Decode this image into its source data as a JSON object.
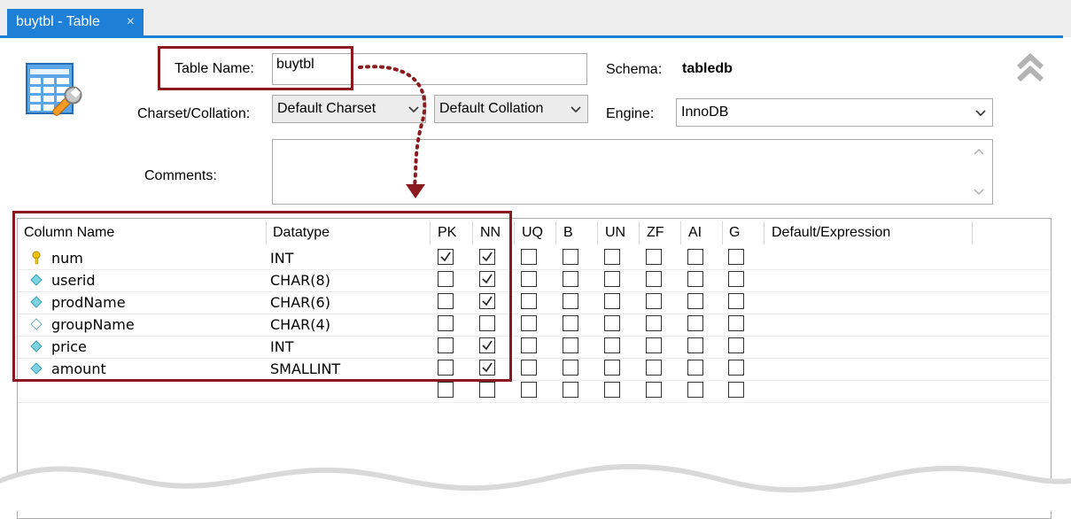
{
  "tab": {
    "title": "buytbl - Table",
    "close": "×"
  },
  "form": {
    "table_name_label": "Table Name:",
    "table_name_value": "buytbl",
    "schema_label": "Schema:",
    "schema_value": "tabledb",
    "charset_label": "Charset/Collation:",
    "charset_value": "Default Charset",
    "collation_value": "Default Collation",
    "engine_label": "Engine:",
    "engine_value": "InnoDB",
    "comments_label": "Comments:",
    "comments_value": ""
  },
  "grid": {
    "headers": [
      "Column Name",
      "Datatype",
      "PK",
      "NN",
      "UQ",
      "B",
      "UN",
      "ZF",
      "AI",
      "G",
      "Default/Expression"
    ],
    "rows": [
      {
        "name": "num",
        "type": "INT",
        "icon": "key-icon",
        "flags": [
          true,
          true,
          false,
          false,
          false,
          false,
          false,
          false
        ]
      },
      {
        "name": "userid",
        "type": "CHAR(8)",
        "icon": "filled-diamond-icon",
        "flags": [
          false,
          true,
          false,
          false,
          false,
          false,
          false,
          false
        ]
      },
      {
        "name": "prodName",
        "type": "CHAR(6)",
        "icon": "filled-diamond-icon",
        "flags": [
          false,
          true,
          false,
          false,
          false,
          false,
          false,
          false
        ]
      },
      {
        "name": "groupName",
        "type": "CHAR(4)",
        "icon": "hollow-diamond-icon",
        "flags": [
          false,
          false,
          false,
          false,
          false,
          false,
          false,
          false
        ]
      },
      {
        "name": "price",
        "type": "INT",
        "icon": "filled-diamond-icon",
        "flags": [
          false,
          true,
          false,
          false,
          false,
          false,
          false,
          false
        ]
      },
      {
        "name": "amount",
        "type": "SMALLINT",
        "icon": "filled-diamond-icon",
        "flags": [
          false,
          true,
          false,
          false,
          false,
          false,
          false,
          false
        ]
      },
      {
        "name": "",
        "type": "",
        "icon": "",
        "flags": [
          false,
          false,
          false,
          false,
          false,
          false,
          false,
          false
        ]
      }
    ]
  },
  "colors": {
    "accent": "#1e7fd6",
    "highlight_border": "#8b1a1f",
    "arrow": "#8b1a1f"
  }
}
